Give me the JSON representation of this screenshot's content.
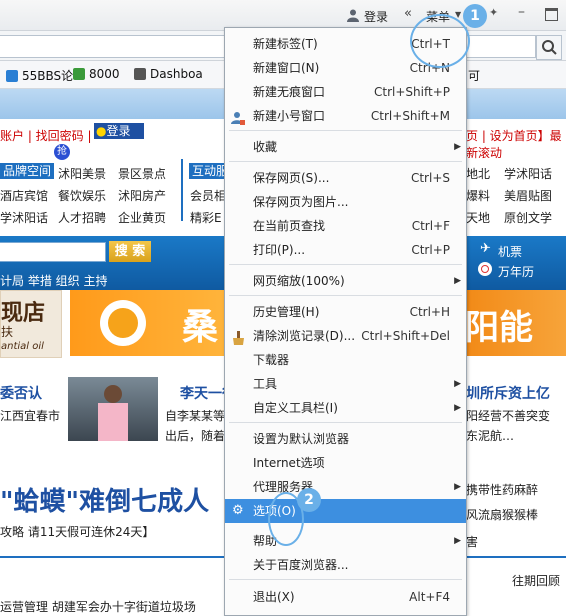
{
  "titlebar": {
    "login": "登录",
    "collapse": "«",
    "menu": "菜单"
  },
  "bookmarks": [
    {
      "label": "55BBS论",
      "color": "#2a7fd4"
    },
    {
      "label": "8000",
      "color": "#3a9a3a"
    },
    {
      "label": "Dashboa",
      "color": "#555555"
    },
    {
      "label": "可",
      "color": "#2a7fd4"
    }
  ],
  "page": {
    "account_links": "账户 | 找回密码 |",
    "login_btn": "登录",
    "right_links": "页 | 设为首页】最新滚动",
    "left_tag1": "品牌空间",
    "left_tag2": "互动服",
    "qiang": "抢",
    "cat_row1": [
      "沭阳美景",
      "景区景点"
    ],
    "cat_row2": [
      "酒店宾馆",
      "餐饮娱乐",
      "沭阳房产"
    ],
    "cat_row3": [
      "学沭阳话",
      "人才招聘",
      "企业黄页"
    ],
    "cat_col3": [
      "会员相",
      "精彩E"
    ],
    "right_row1": [
      "地北",
      "学沭阳话"
    ],
    "right_row2": [
      "爆料",
      "美眉贴图"
    ],
    "right_row3": [
      "天地",
      "原创文学"
    ],
    "search_btn": "搜 索",
    "nav_links": "计局 举措 组织 主持",
    "ticket": "机票",
    "calendar": "万年历",
    "banner_left1": "现店",
    "banner_left2": "扶",
    "banner_left3": "antial oil",
    "banner_mid": "桑",
    "banner_right": "阳能",
    "news_left_title": "委否认",
    "news_left_sub": "江西宜春市",
    "news_mid_title": "李天一律",
    "news_mid_sub1": "自李某某等",
    "news_mid_sub2": "出后，随着",
    "news_right_title": "圳所斥资上亿",
    "news_right_sub1": "阳经营不善突变",
    "news_right_sub2": "东泥航…",
    "headline": "\"蛤蟆\"难倒七成人",
    "headline_sub": "攻略 请11天假可连休24天】",
    "right_item1": "携带性药麻醉",
    "right_item2": "风流扇猴猴棒",
    "right_item3": "害",
    "footer_right": "往期回顾",
    "footer_left": "运营管理 胡建军会办十字街道垃圾场"
  },
  "menu": {
    "items": [
      {
        "label": "新建标签(T)",
        "shortcut": "Ctrl+T"
      },
      {
        "label": "新建窗口(N)",
        "shortcut": "Ctrl+N"
      },
      {
        "label": "新建无痕窗口",
        "shortcut": "Ctrl+Shift+P"
      },
      {
        "label": "新建小号窗口",
        "shortcut": "Ctrl+Shift+M"
      },
      {
        "label": "收藏",
        "shortcut": ""
      },
      {
        "label": "保存网页(S)...",
        "shortcut": "Ctrl+S"
      },
      {
        "label": "保存网页为图片...",
        "shortcut": ""
      },
      {
        "label": "在当前页查找",
        "shortcut": "Ctrl+F"
      },
      {
        "label": "打印(P)...",
        "shortcut": "Ctrl+P"
      },
      {
        "label": "网页缩放(100%)",
        "shortcut": ""
      },
      {
        "label": "历史管理(H)",
        "shortcut": "Ctrl+H"
      },
      {
        "label": "清除浏览记录(D)...",
        "shortcut": "Ctrl+Shift+Del"
      },
      {
        "label": "下载器",
        "shortcut": ""
      },
      {
        "label": "工具",
        "shortcut": ""
      },
      {
        "label": "自定义工具栏(I)",
        "shortcut": ""
      },
      {
        "label": "设置为默认浏览器",
        "shortcut": ""
      },
      {
        "label": "Internet选项",
        "shortcut": ""
      },
      {
        "label": "代理服务器",
        "shortcut": ""
      },
      {
        "label": "选项(O)",
        "shortcut": ""
      },
      {
        "label": "帮助",
        "shortcut": ""
      },
      {
        "label": "关于百度浏览器...",
        "shortcut": ""
      },
      {
        "label": "退出(X)",
        "shortcut": "Alt+F4"
      }
    ]
  },
  "callouts": {
    "step1": "1",
    "step2": "2"
  },
  "colors": {
    "accent": "#3d8fe0",
    "callout": "#6ab0e8"
  }
}
